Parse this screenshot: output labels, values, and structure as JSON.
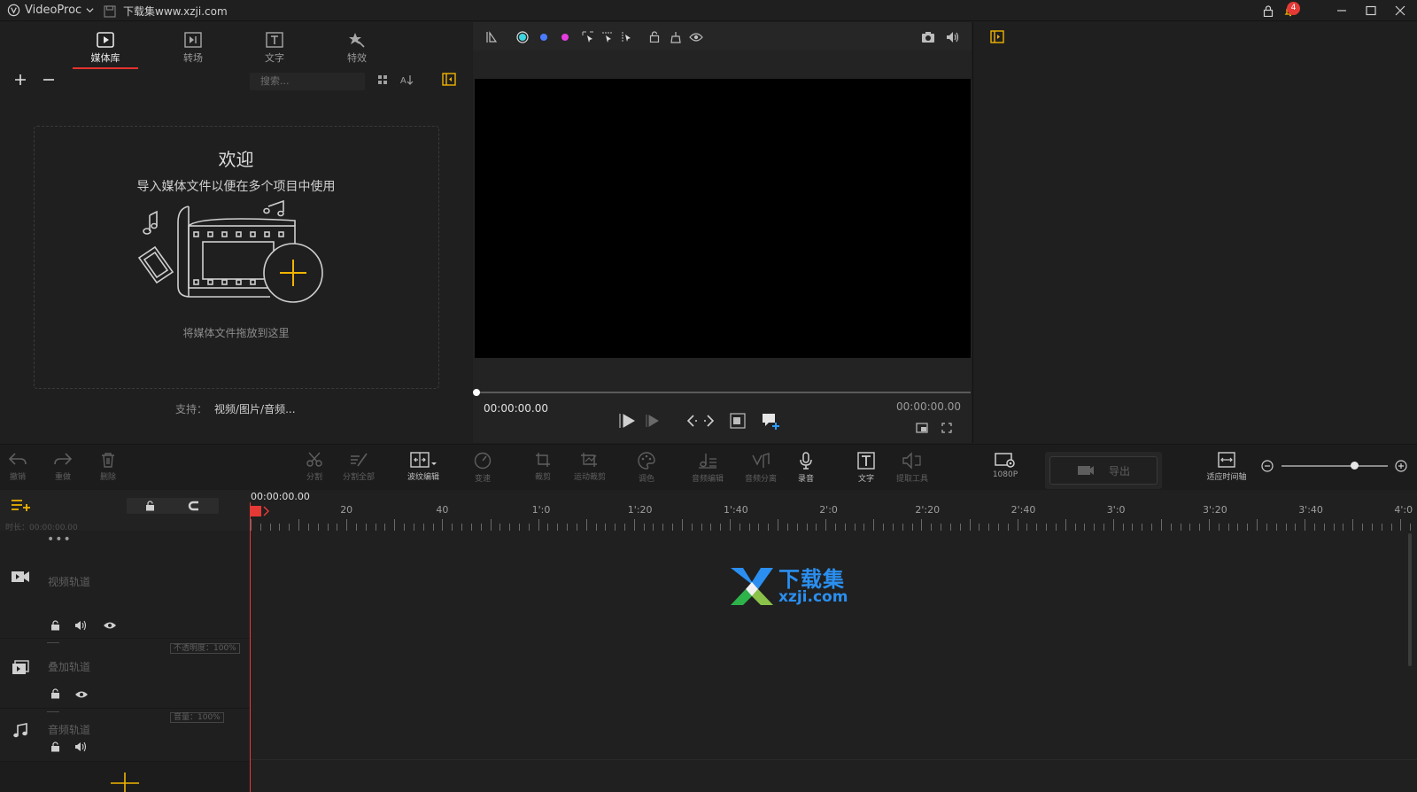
{
  "titlebar": {
    "app_name": "VideoProc",
    "project_name": "下载集www.xzji.com",
    "notification_count": "4"
  },
  "media_tabs": [
    {
      "label": "媒体库",
      "icon": "media-library-icon",
      "active": true
    },
    {
      "label": "转场",
      "icon": "transition-icon",
      "active": false
    },
    {
      "label": "文字",
      "icon": "text-icon",
      "active": false
    },
    {
      "label": "特效",
      "icon": "effects-icon",
      "active": false
    }
  ],
  "library": {
    "search_placeholder": "搜索...",
    "welcome_title": "欢迎",
    "welcome_subtitle": "导入媒体文件以便在多个项目中使用",
    "drop_hint": "将媒体文件拖放到这里",
    "support_label": "支持：",
    "support_types": "视频/图片/音频..."
  },
  "preview": {
    "timecode_current": "00:00:00.00",
    "timecode_total": "00:00:00.00"
  },
  "toolbar": {
    "undo": "撤销",
    "redo": "重做",
    "delete": "删除",
    "split": "分割",
    "split_all": "分割全部",
    "wave_edit": "波纹编辑",
    "speed": "变速",
    "crop": "裁剪",
    "motion_crop": "运动裁剪",
    "color": "调色",
    "audio_edit": "音频编辑",
    "audio_split": "音频分离",
    "record": "录音",
    "text": "文字",
    "extract_tool": "提取工具",
    "resolution": "1080P",
    "export": "导出",
    "fit_timeline": "适应时间轴"
  },
  "timeline": {
    "playhead_time": "00:00:00.00",
    "duration_label": "时长：00:00:00.00",
    "ruler_labels": [
      "20",
      "40",
      "1':0",
      "1':20",
      "1':40",
      "2':0",
      "2':20",
      "2':40",
      "3':0",
      "3':20",
      "3':40",
      "4':0"
    ],
    "zoom_level": 0.68,
    "tracks": {
      "video": "视频轨道",
      "overlay": "叠加轨道",
      "overlay_opacity": "不透明度：100%",
      "audio": "音频轨道",
      "audio_volume": "音量：100%"
    }
  },
  "watermark": {
    "name": "下载集",
    "url": "xzji.com"
  },
  "colors": {
    "accent_yellow": "#f0b400",
    "accent_red": "#e53935",
    "bg": "#1f1f1f"
  }
}
